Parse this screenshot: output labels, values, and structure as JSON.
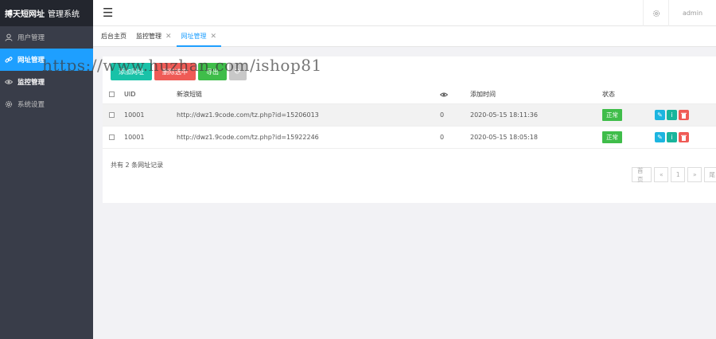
{
  "brand": {
    "primary": "搏天短网址",
    "secondary": "管理系统"
  },
  "sidebar": {
    "items": [
      {
        "label": "用户管理",
        "icon": "user-icon"
      },
      {
        "label": "网址管理",
        "icon": "link-icon"
      },
      {
        "label": "监控管理",
        "icon": "eye-icon"
      },
      {
        "label": "系统设置",
        "icon": "gear-icon"
      }
    ]
  },
  "header": {
    "menu_icon": "☰",
    "user": "admin"
  },
  "tabs": [
    {
      "label": "后台主页"
    },
    {
      "label": "监控管理"
    },
    {
      "label": "网址管理"
    }
  ],
  "toolbar": {
    "add": "添加网址",
    "delete": "删除选中",
    "export": "导出"
  },
  "table": {
    "headers": {
      "uid": "UID",
      "url": "新浪短链",
      "time": "添加时间",
      "status": "状态"
    },
    "rows": [
      {
        "uid": "10001",
        "url": "http://dwz1.9code.com/tz.php?id=15206013",
        "views": "0",
        "time": "2020-05-15 18:11:36",
        "status": "正常"
      },
      {
        "uid": "10001",
        "url": "http://dwz1.9code.com/tz.php?id=15922246",
        "views": "0",
        "time": "2020-05-15 18:05:18",
        "status": "正常"
      }
    ]
  },
  "footer": {
    "total": "共有 2 条网址记录"
  },
  "pagination": {
    "first": "首页",
    "prev": "«",
    "page": "1",
    "next": "»",
    "last": "尾"
  },
  "watermark": "https://www.huzhan.com/ishop81",
  "colors": {
    "accent": "#1e9fff",
    "sidebar": "#393d49",
    "brand_bg": "#23262e",
    "success": "#3fbd4a",
    "danger": "#ef5b56",
    "teal": "#19c2a8"
  }
}
